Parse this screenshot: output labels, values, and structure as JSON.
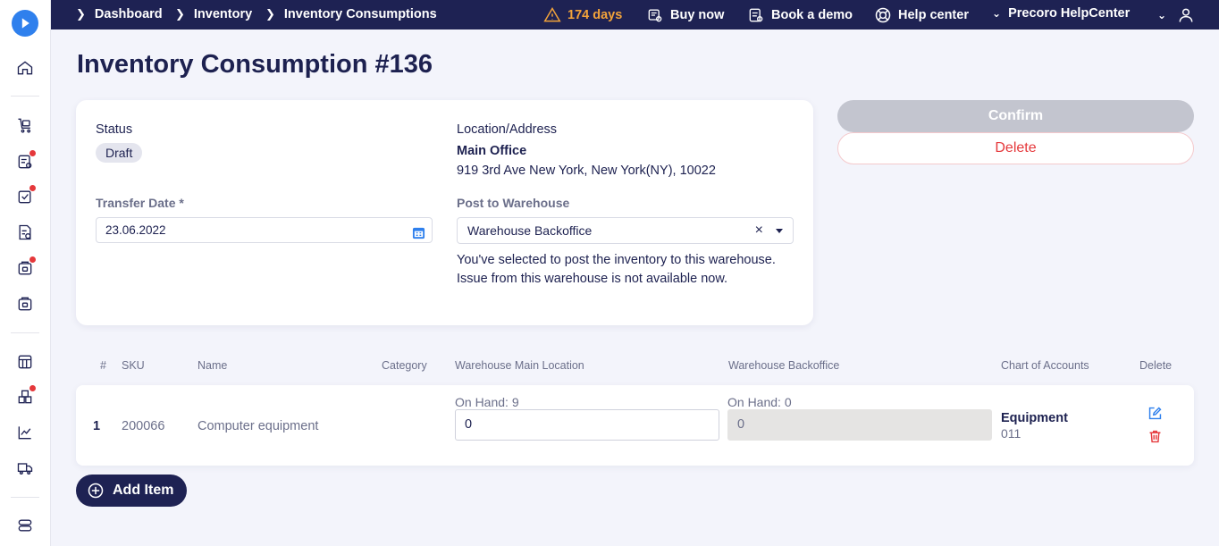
{
  "breadcrumbs": [
    "Dashboard",
    "Inventory",
    "Inventory Consumptions"
  ],
  "topbar": {
    "trial_days": "174 days",
    "buy_now": "Buy now",
    "book_demo": "Book a demo",
    "help_center": "Help center",
    "company": "Precoro HelpCenter"
  },
  "page_title": "Inventory Consumption #136",
  "form": {
    "status_label": "Status",
    "status_value": "Draft",
    "transfer_date_label": "Transfer Date *",
    "transfer_date_value": "23.06.2022",
    "location_label": "Location/Address",
    "location_name": "Main Office",
    "location_address": "919 3rd Ave New York, New York(NY), 10022",
    "post_to_warehouse_label": "Post to Warehouse",
    "post_to_warehouse_value": "Warehouse Backoffice",
    "clear_symbol": "×",
    "warehouse_note": "You've selected to post the inventory to this warehouse. Issue from this warehouse is not available now."
  },
  "actions": {
    "confirm": "Confirm",
    "delete": "Delete"
  },
  "table": {
    "columns": [
      "#",
      "SKU",
      "Name",
      "Category",
      "Warehouse Main Location",
      "Warehouse Backoffice",
      "Chart of Accounts",
      "Delete"
    ],
    "rows": [
      {
        "index": "1",
        "sku": "200066",
        "name": "Computer equipment",
        "category": "",
        "main_on_hand": "On Hand: 9",
        "main_qty": "0",
        "backoffice_on_hand": "On Hand: 0",
        "backoffice_qty": "0",
        "account_name": "Equipment",
        "account_code": "011"
      }
    ]
  },
  "add_item": "Add Item",
  "colors": {
    "navy": "#1e2253",
    "accent_blue": "#2f80ed",
    "danger": "#e5383b",
    "warning": "#f2a33a",
    "disabled": "#c3c5cf"
  }
}
